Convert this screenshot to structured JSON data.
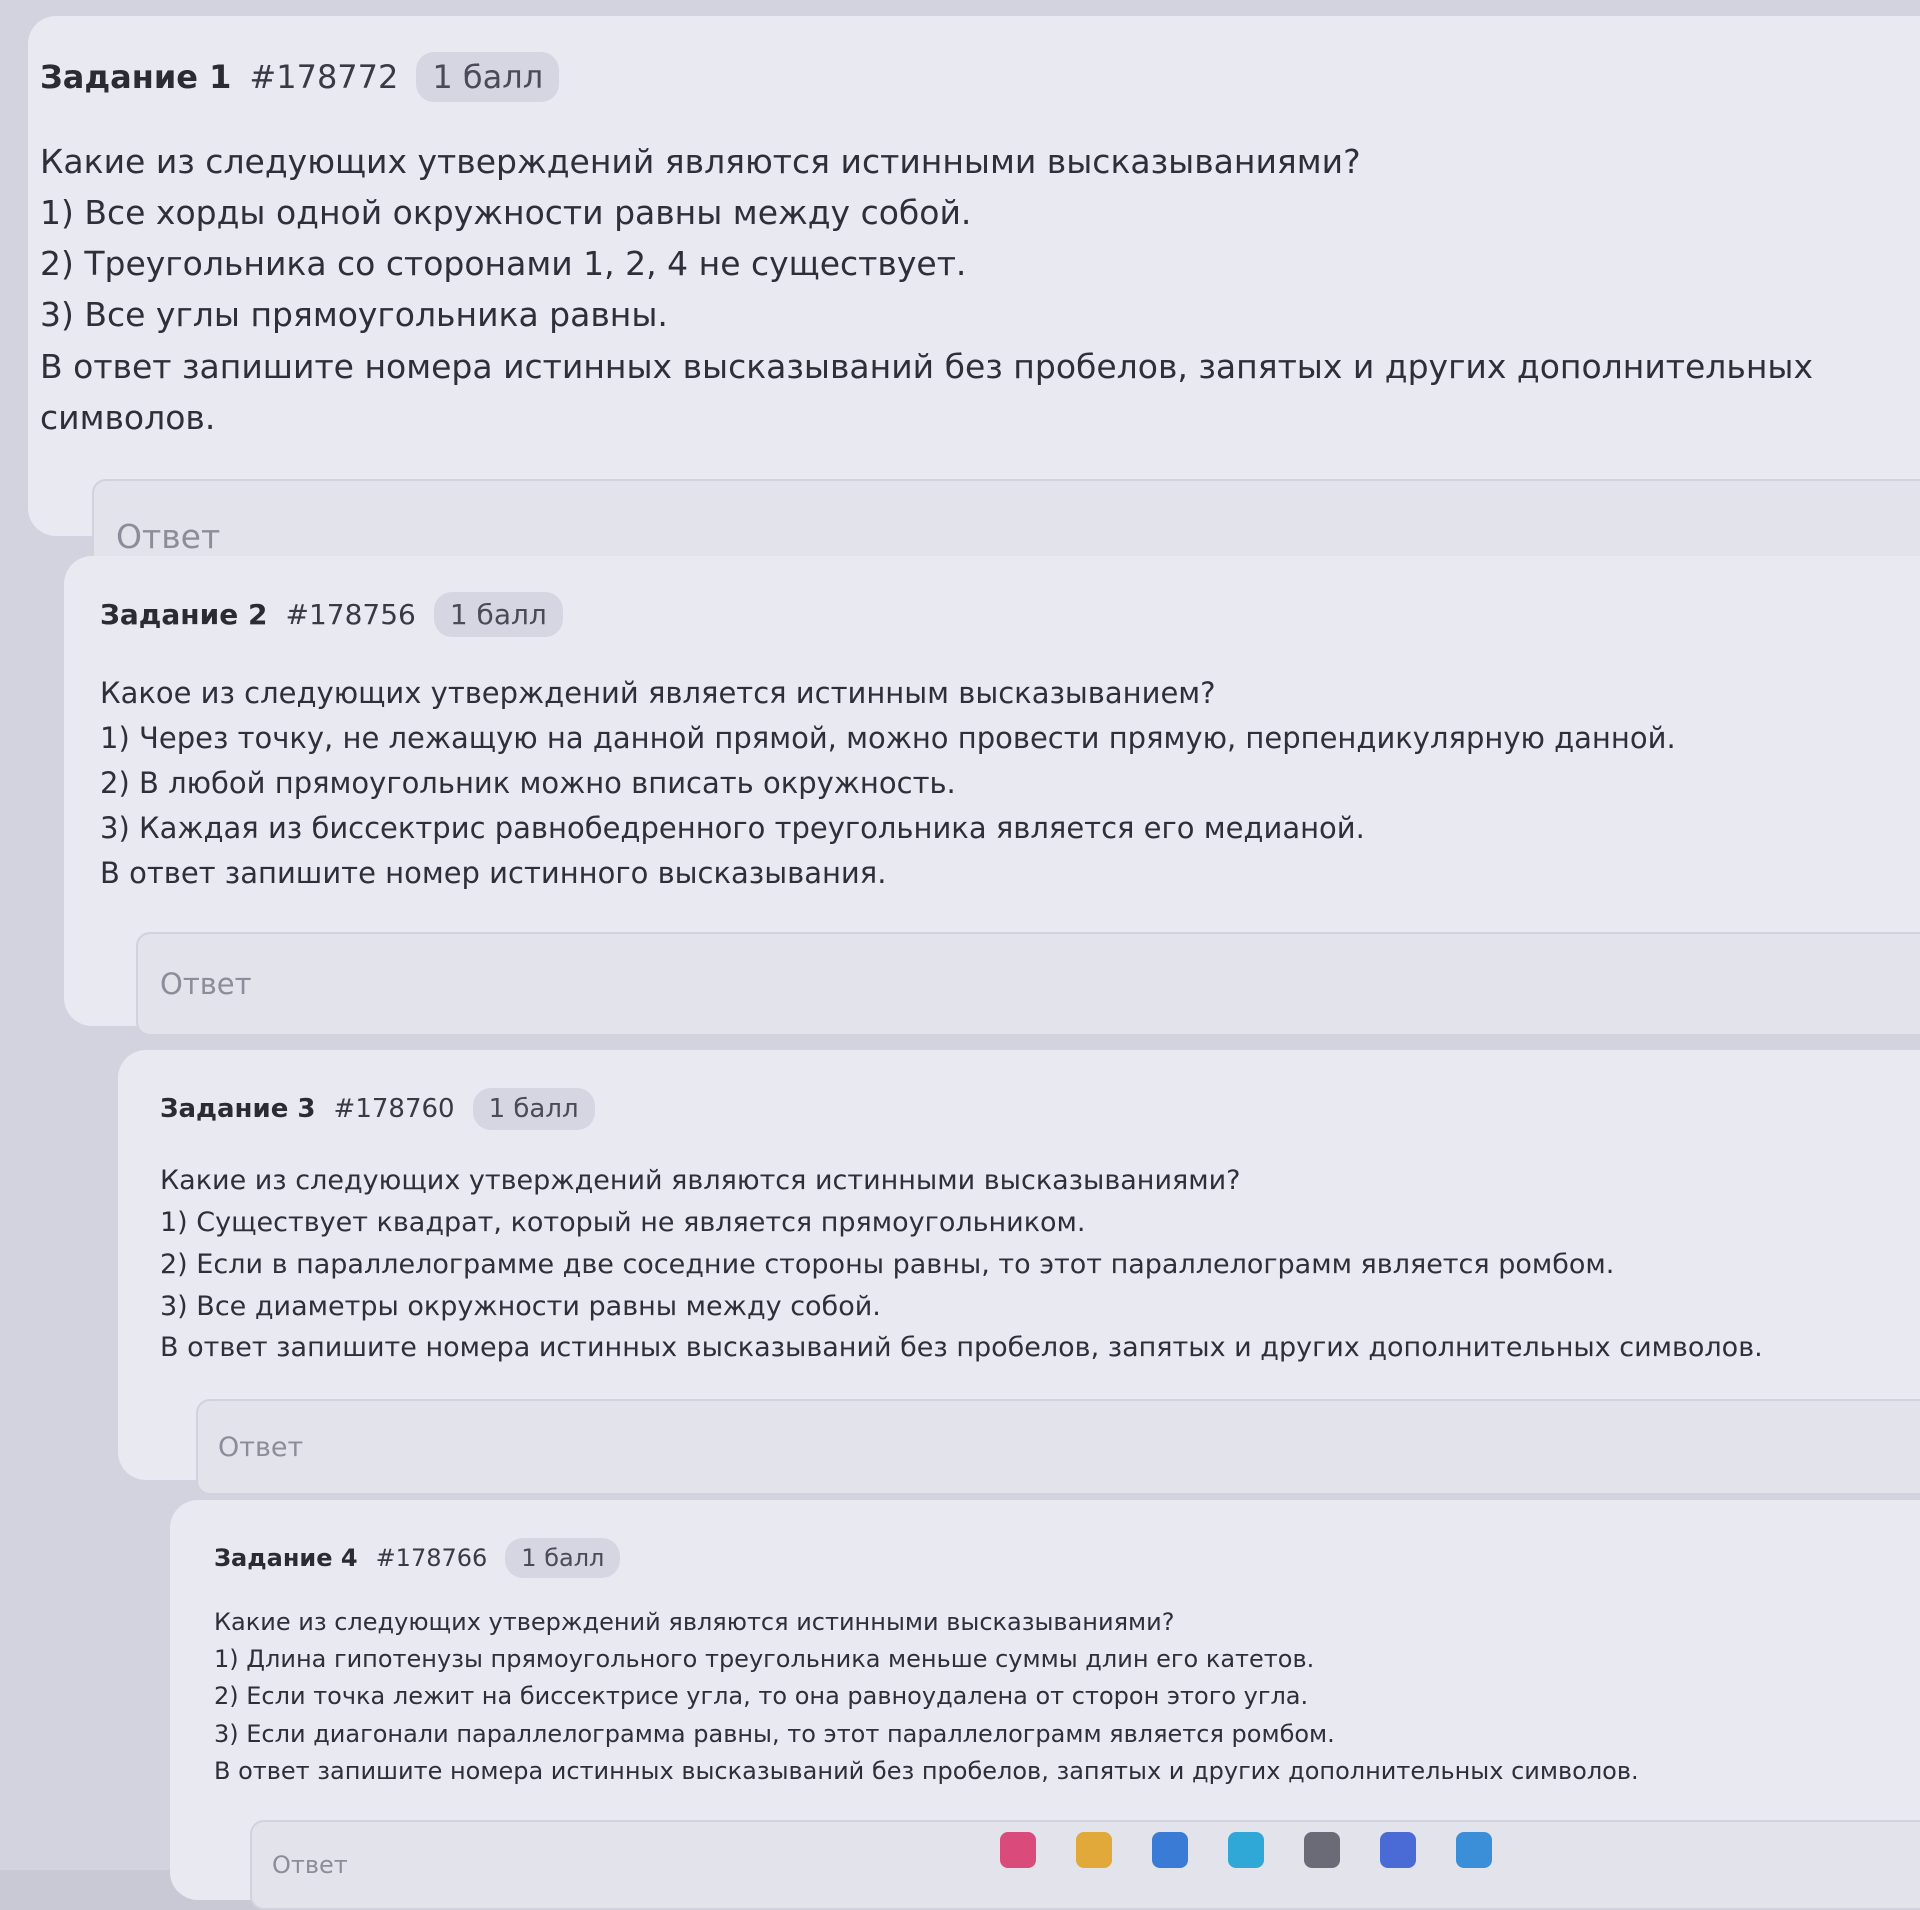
{
  "tasks": [
    {
      "title": "Задание 1",
      "id": "#178772",
      "points": "1 балл",
      "question": "Какие из следующих утверждений являются истинными высказываниями?",
      "statements": [
        "1) Все хорды одной окружности равны между собой.",
        "2) Треугольника со сторонами 1, 2, 4 не существует.",
        "3) Все углы прямоугольника равны."
      ],
      "instruction": "В ответ запишите номера истинных высказываний без пробелов, запятых и других дополнительных символов.",
      "answer_placeholder": "Ответ",
      "answer_value": ""
    },
    {
      "title": "Задание 2",
      "id": "#178756",
      "points": "1 балл",
      "question": "Какое из следующих утверждений является истинным высказыванием?",
      "statements": [
        "1) Через точку, не лежащую на данной прямой, можно провести прямую, перпендикулярную данной.",
        "2) В любой прямоугольник можно вписать окружность.",
        "3) Каждая из биссектрис равнобедренного треугольника является его медианой."
      ],
      "instruction": "В ответ запишите номер истинного высказывания.",
      "answer_placeholder": "Ответ",
      "answer_value": ""
    },
    {
      "title": "Задание 3",
      "id": "#178760",
      "points": "1 балл",
      "question": "Какие из следующих утверждений являются истинными высказываниями?",
      "statements": [
        "1) Существует квадрат, который не является прямоугольником.",
        "2) Если в параллелограмме две соседние стороны равны, то этот параллелограмм является ромбом.",
        "3) Все диаметры окружности равны между собой."
      ],
      "instruction": "В ответ запишите номера истинных высказываний без пробелов, запятых и других дополнительных символов.",
      "answer_placeholder": "Ответ",
      "answer_value": ""
    },
    {
      "title": "Задание 4",
      "id": "#178766",
      "points": "1 балл",
      "question": "Какие из следующих утверждений являются истинными высказываниями?",
      "statements": [
        "1) Длина гипотенузы прямоугольного треугольника меньше суммы длин его катетов.",
        "2) Если точка лежит на биссектрисе угла, то она равноудалена от сторон этого угла.",
        "3) Если диагонали параллелограмма равны, то этот параллелограмм является ромбом."
      ],
      "instruction": "В ответ запишите номера истинных высказываний без пробелов, запятых и других дополнительных символов.",
      "answer_placeholder": "Ответ",
      "answer_value": ""
    }
  ],
  "taskbar": {
    "icons": [
      "mail-icon",
      "folder-icon",
      "calendar-icon",
      "edge-browser-icon",
      "settings-icon",
      "charts-icon",
      "telegram-icon"
    ],
    "colors": {
      "mail-icon": "#d94b7a",
      "folder-icon": "#e0a93a",
      "calendar-icon": "#3a7bd5",
      "edge-browser-icon": "#2fa8d8",
      "settings-icon": "#6b6b78",
      "charts-icon": "#4a6bd6",
      "telegram-icon": "#3b8fd9"
    }
  }
}
